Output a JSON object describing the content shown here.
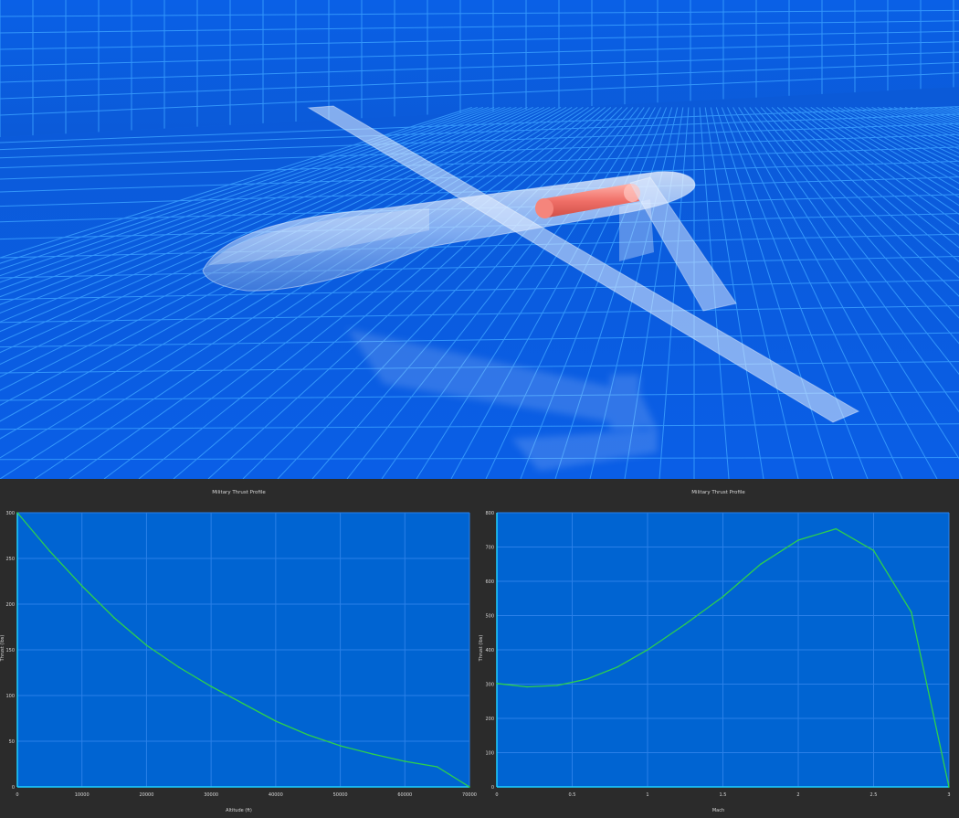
{
  "colors": {
    "viewport_background": "#0a5ee0",
    "grid_line": "#3aa0ff",
    "plot_background": "#0064d2",
    "plot_line": "#2ed14a",
    "plot_axis": "#1fd0ff",
    "panel_background": "#2b2b2b",
    "engine": "#f07068"
  },
  "charts": {
    "altitude": {
      "title": "Military Thrust Profile",
      "xlabel": "Altitude (ft)",
      "ylabel": "Thrust (lbs)"
    },
    "mach": {
      "title": "Military Thrust Profile",
      "xlabel": "Mach",
      "ylabel": "Thrust (lbs)"
    }
  },
  "chart_data": [
    {
      "type": "line",
      "title": "Military Thrust Profile",
      "xlabel": "Altitude (ft)",
      "ylabel": "Thrust (lbs)",
      "xlim": [
        0,
        70000
      ],
      "ylim": [
        0,
        300
      ],
      "xticks": [
        "0",
        "10000",
        "20000",
        "30000",
        "40000",
        "50000",
        "60000",
        "70000"
      ],
      "yticks": [
        "0",
        "50",
        "100",
        "150",
        "200",
        "250",
        "300"
      ],
      "grid": true,
      "series": [
        {
          "x": [
            0,
            5000,
            10000,
            15000,
            20000,
            25000,
            30000,
            35000,
            40000,
            45000,
            50000,
            55000,
            60000,
            65000,
            70000
          ],
          "y": [
            300,
            258,
            220,
            185,
            155,
            131,
            110,
            91,
            72,
            57,
            45,
            36,
            28,
            22,
            0
          ]
        }
      ]
    },
    {
      "type": "line",
      "title": "Military Thrust Profile",
      "xlabel": "Mach",
      "ylabel": "Thrust (lbs)",
      "xlim": [
        0,
        3
      ],
      "ylim": [
        0,
        800
      ],
      "xticks": [
        "0",
        "0.5",
        "1",
        "1.5",
        "2",
        "2.5",
        "3"
      ],
      "yticks": [
        "0",
        "100",
        "200",
        "300",
        "400",
        "500",
        "600",
        "700",
        "800"
      ],
      "grid": true,
      "series": [
        {
          "x": [
            0,
            0.2,
            0.4,
            0.6,
            0.8,
            1.0,
            1.25,
            1.5,
            1.75,
            2.0,
            2.25,
            2.5,
            2.75,
            3.0
          ],
          "y": [
            302,
            292,
            296,
            315,
            350,
            400,
            475,
            555,
            650,
            720,
            753,
            690,
            510,
            0
          ]
        }
      ]
    }
  ]
}
